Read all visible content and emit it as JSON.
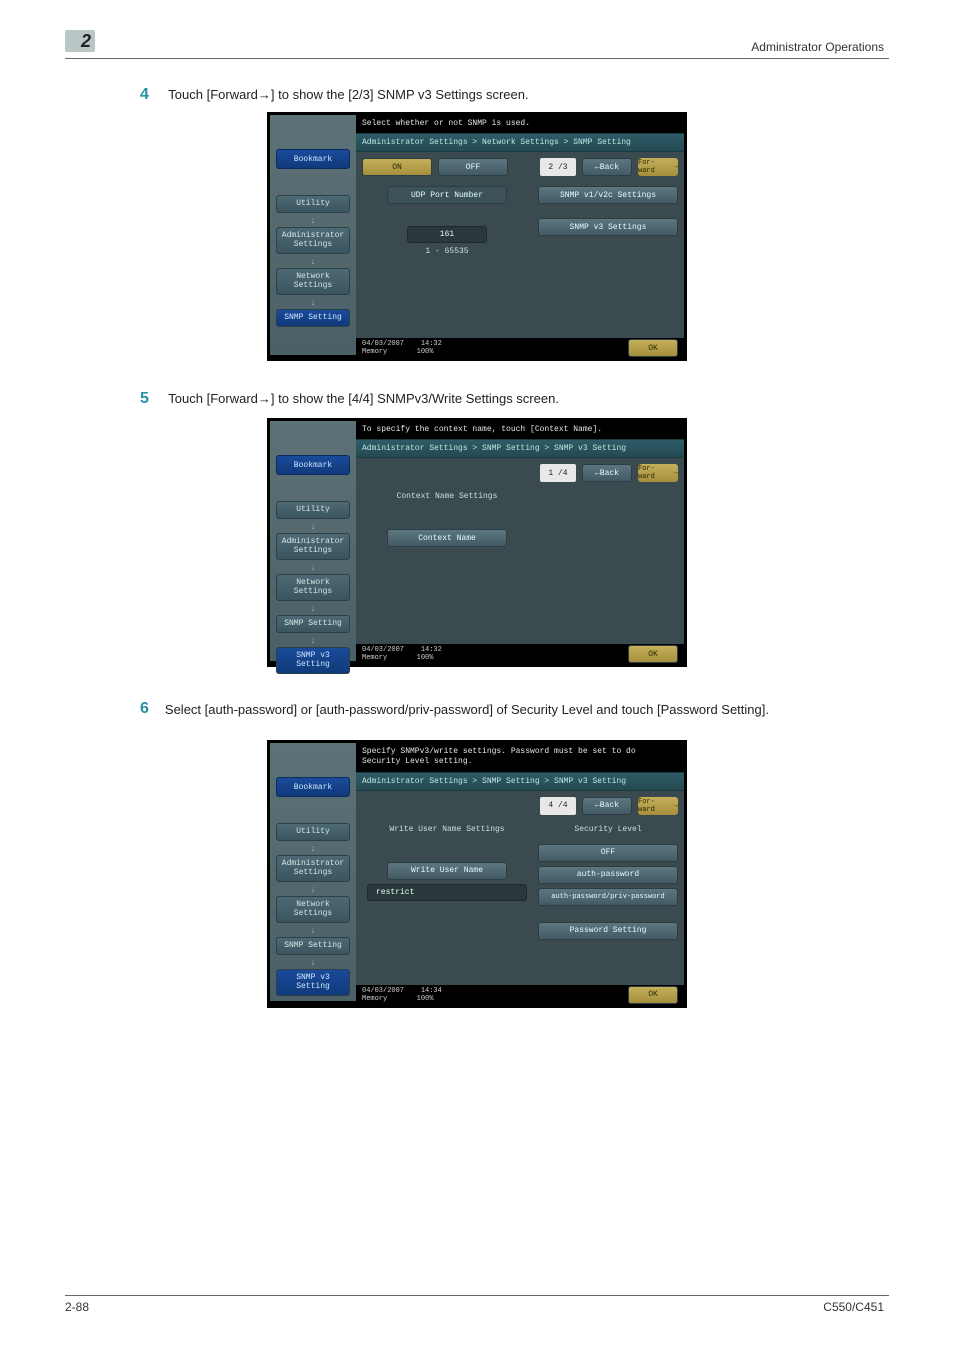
{
  "page": {
    "header_title": "Administrator Operations",
    "chapter_num": "2",
    "footer_page": "2-88",
    "footer_model": "C550/C451"
  },
  "steps": {
    "s4": {
      "num": "4",
      "text": "Touch [Forward→] to show the [2/3] SNMP v3 Settings screen."
    },
    "s5": {
      "num": "5",
      "text": "Touch [Forward→] to show the [4/4] SNMPv3/Write Settings screen."
    },
    "s6": {
      "num": "6",
      "text": "Select [auth-password] or [auth-password/priv-password] of Security Level and touch [Password Setting]."
    }
  },
  "sidebar": {
    "bookmark": "Bookmark",
    "items": [
      "Utility",
      "Administrator Settings",
      "Network Settings",
      "SNMP Setting",
      "SNMP v3 Setting"
    ]
  },
  "screen1": {
    "topbar": "Select whether or not SNMP is used.",
    "breadcrumb": "Administrator Settings > Network Settings > SNMP Setting",
    "on": "ON",
    "off": "OFF",
    "page": "2 /3",
    "back": "←Back",
    "fwd": "For- ward",
    "udp_label": "UDP Port Number",
    "udp_value": "161",
    "udp_range": "1  -  65535",
    "btn_v1v2c": "SNMP v1/v2c Settings",
    "btn_v3": "SNMP v3 Settings",
    "date": "04/03/2007",
    "time": "14:32",
    "mem": "Memory",
    "mempct": "100%",
    "ok": "OK"
  },
  "screen2": {
    "topbar": "To specify the context name, touch [Context Name].",
    "breadcrumb": "Administrator Settings > SNMP Setting > SNMP v3 Setting",
    "page": "1 /4",
    "back": "←Back",
    "fwd": "For- ward",
    "hdr": "Context Name Settings",
    "btn_ctx": "Context Name",
    "date": "04/03/2007",
    "time": "14:32",
    "mem": "Memory",
    "mempct": "100%",
    "ok": "OK"
  },
  "screen3": {
    "topbar": "Specify SNMPv3/write settings. Password must be set to do Security Level setting.",
    "breadcrumb": "Administrator Settings > SNMP Setting > SNMP v3 Setting",
    "page": "4 /4",
    "back": "←Back",
    "fwd": "For- ward",
    "hdr_left": "Write User Name Settings",
    "hdr_right": "Security Level",
    "btn_user": "Write User Name",
    "user_value": "restrict",
    "opt_off": "OFF",
    "opt_auth": "auth-password",
    "opt_authpriv": "auth-password/priv-password",
    "btn_pw": "Password Setting",
    "date": "04/03/2007",
    "time": "14:34",
    "mem": "Memory",
    "mempct": "100%",
    "ok": "OK"
  }
}
